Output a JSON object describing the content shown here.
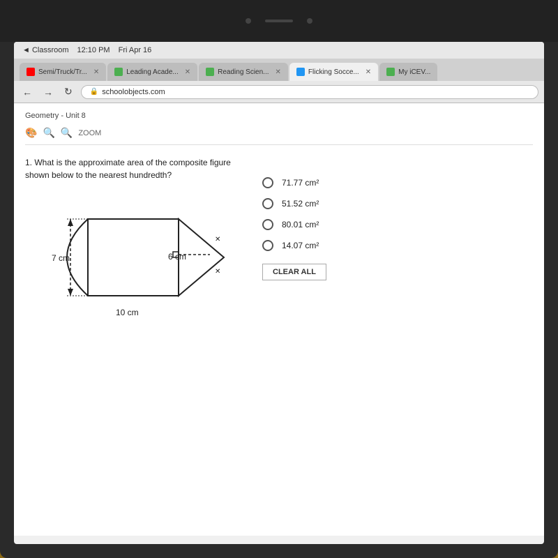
{
  "device": {
    "status_bar": {
      "back_label": "◄ Classroom",
      "time": "12:10 PM",
      "date": "Fri Apr 16"
    }
  },
  "browser": {
    "tabs": [
      {
        "id": "tab1",
        "favicon_color": "#ff0000",
        "label": "Semi/Truck/Tr...",
        "active": false
      },
      {
        "id": "tab2",
        "favicon_color": "#4CAF50",
        "label": "Leading Acade...",
        "active": false
      },
      {
        "id": "tab3",
        "favicon_color": "#4CAF50",
        "label": "Reading Scien...",
        "active": false
      },
      {
        "id": "tab4",
        "favicon_color": "#2196F3",
        "label": "Flicking Socce...",
        "active": true
      },
      {
        "id": "tab5",
        "favicon_color": "#4CAF50",
        "label": "My iCEV...",
        "active": false
      }
    ],
    "address": "schoolobjects.com",
    "nav": {
      "back": "←",
      "forward": "→",
      "reload": "↻"
    }
  },
  "page": {
    "breadcrumb": "Geometry - Unit 8",
    "toolbar": {
      "palette_icon": "🎨",
      "zoom_minus_icon": "🔍",
      "zoom_plus_icon": "🔍",
      "zoom_label": "ZOOM"
    },
    "question": {
      "number": "1.",
      "text": "What is the approximate area of the composite figure shown below to the nearest hundredth?",
      "figure": {
        "label_7cm": "7 cm",
        "label_10cm": "10 cm",
        "label_6cm": "6 cm"
      },
      "answers": [
        {
          "id": "a",
          "text": "71.77 cm²",
          "selected": false
        },
        {
          "id": "b",
          "text": "51.52 cm²",
          "selected": false
        },
        {
          "id": "c",
          "text": "80.01 cm²",
          "selected": false
        },
        {
          "id": "d",
          "text": "14.07 cm²",
          "selected": false
        }
      ],
      "clear_all_label": "CLEAR ALL"
    }
  }
}
